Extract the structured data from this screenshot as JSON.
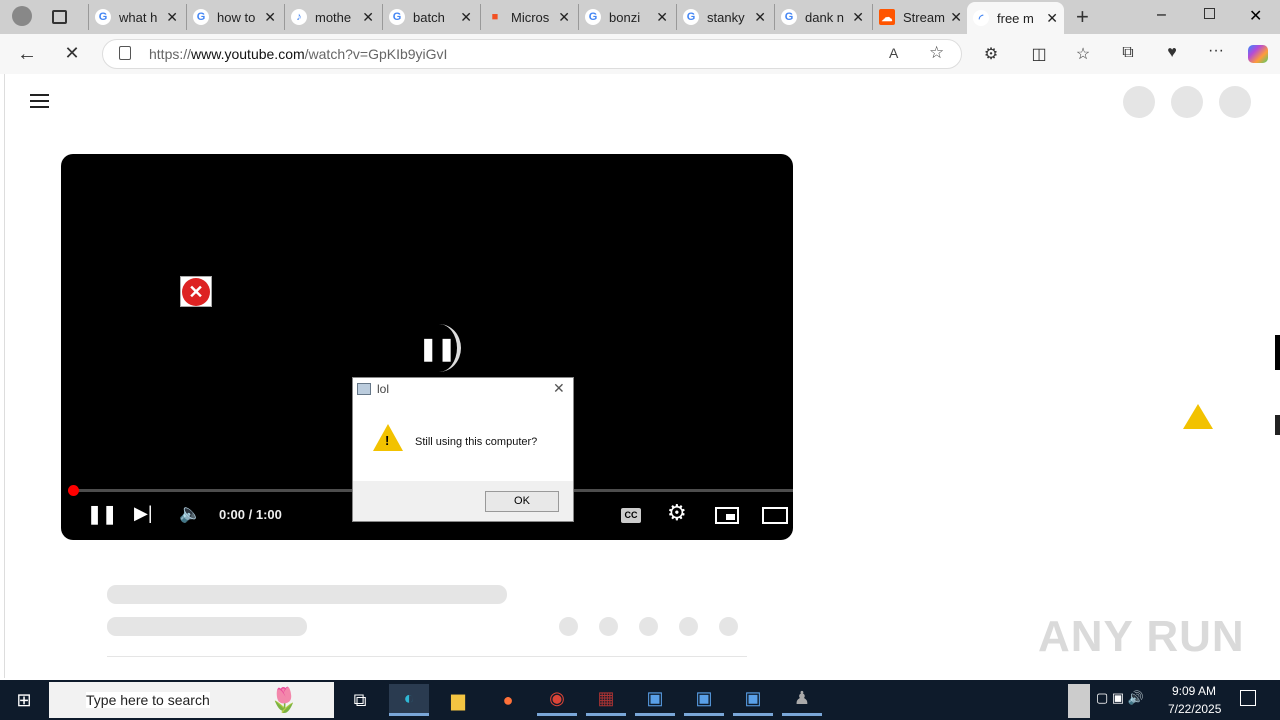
{
  "tabs": [
    {
      "label": "what h",
      "icon": "google-icon"
    },
    {
      "label": "how to",
      "icon": "google-icon"
    },
    {
      "label": "mothe",
      "icon": "muted-page-icon"
    },
    {
      "label": "batch",
      "icon": "google-icon"
    },
    {
      "label": "Micros",
      "icon": "microsoft-icon"
    },
    {
      "label": "bonzi",
      "icon": "google-icon"
    },
    {
      "label": "stanky",
      "icon": "google-icon"
    },
    {
      "label": "dank n",
      "icon": "google-icon"
    },
    {
      "label": "Stream",
      "icon": "soundcloud-icon"
    },
    {
      "label": "free m",
      "icon": "loading-icon"
    }
  ],
  "address": {
    "prefix": "https://",
    "host": "www.youtube.com",
    "path": "/watch?v=GpKIb9yiGvI"
  },
  "player": {
    "time": "0:00 / 1:00",
    "progress": 0
  },
  "dialog": {
    "title": "lol",
    "message": "Still using this computer?",
    "ok": "OK"
  },
  "taskbar": {
    "search_placeholder": "Type here to search",
    "time": "9:09 AM",
    "date": "7/22/2025"
  },
  "watermark": "ANY RUN",
  "colors": {
    "accent": "#ff0000",
    "taskbar": "#0e1b2b"
  }
}
